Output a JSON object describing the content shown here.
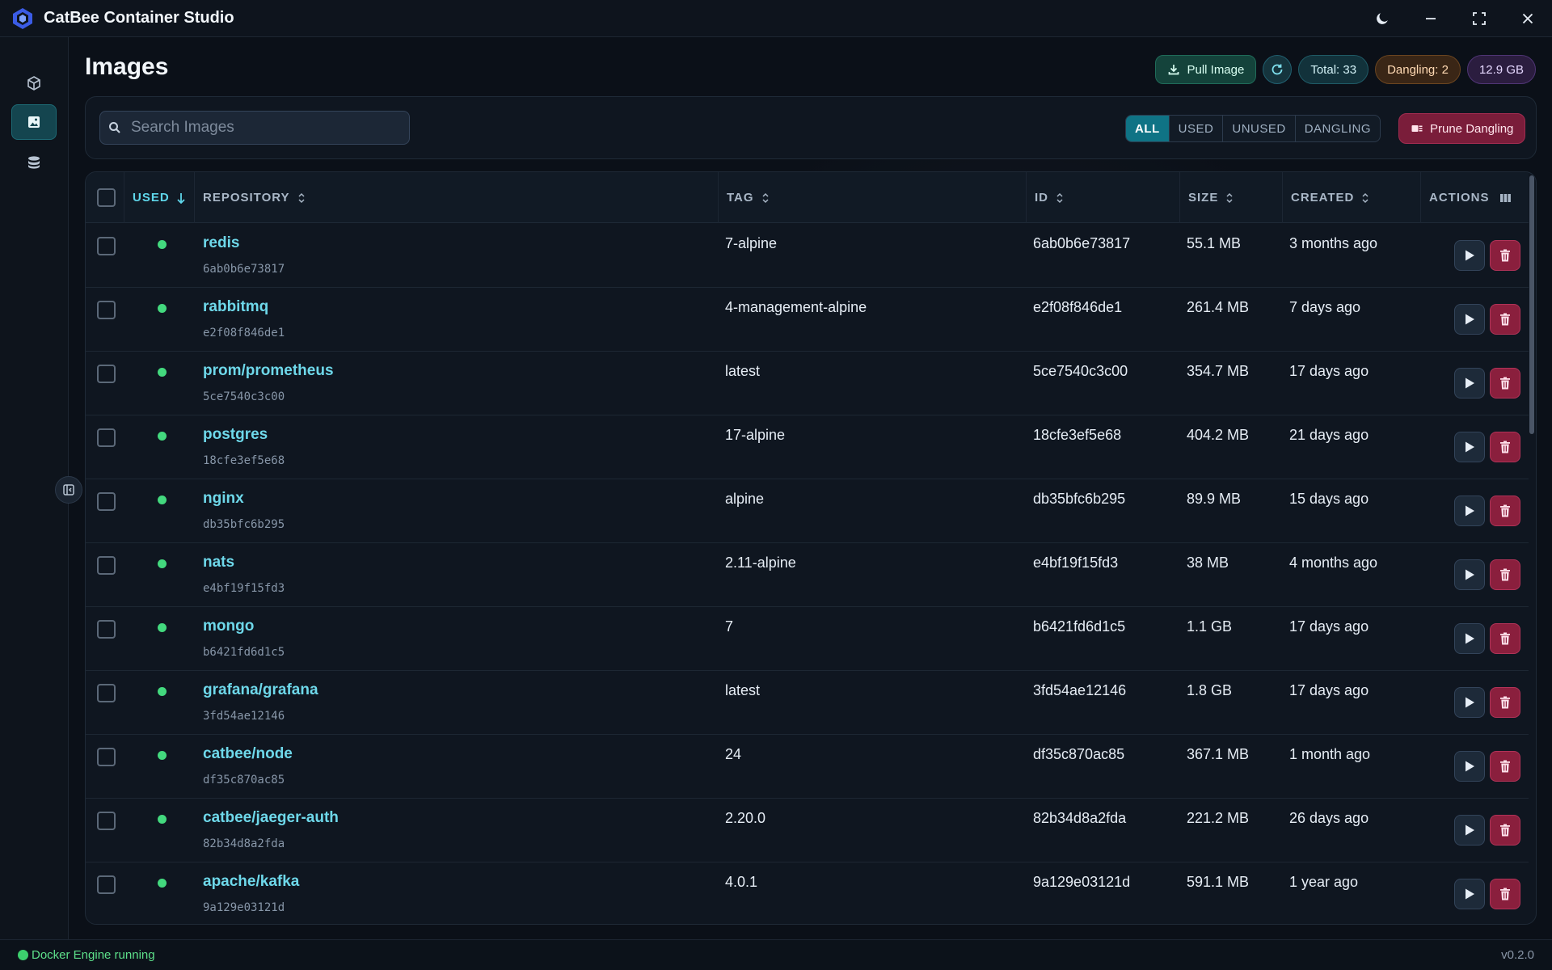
{
  "app": {
    "title": "CatBee Container Studio",
    "version": "v0.2.0"
  },
  "sidebar": {
    "items": [
      {
        "label": "Containers",
        "icon": "cube-icon",
        "active": false
      },
      {
        "label": "Images",
        "icon": "image-icon",
        "active": true
      },
      {
        "label": "Volumes",
        "icon": "database-icon",
        "active": false
      }
    ]
  },
  "header": {
    "title": "Images",
    "pull_label": "Pull Image",
    "total": "Total: 33",
    "dangling": "Dangling: 2",
    "size": "12.9 GB"
  },
  "filters": {
    "search_placeholder": "Search Images",
    "tabs": [
      "ALL",
      "USED",
      "UNUSED",
      "DANGLING"
    ],
    "active_tab": "ALL",
    "prune_label": "Prune Dangling"
  },
  "table": {
    "columns": {
      "used": "USED",
      "repository": "REPOSITORY",
      "tag": "TAG",
      "id": "ID",
      "size": "SIZE",
      "created": "CREATED",
      "actions": "ACTIONS"
    },
    "sort": {
      "column": "USED",
      "direction": "desc"
    },
    "rows": [
      {
        "repository": "redis",
        "short_id": "6ab0b6e73817",
        "tag": "7-alpine",
        "id": "6ab0b6e73817",
        "size": "55.1 MB",
        "created": "3 months ago",
        "used": true
      },
      {
        "repository": "rabbitmq",
        "short_id": "e2f08f846de1",
        "tag": "4-management-alpine",
        "id": "e2f08f846de1",
        "size": "261.4 MB",
        "created": "7 days ago",
        "used": true
      },
      {
        "repository": "prom/prometheus",
        "short_id": "5ce7540c3c00",
        "tag": "latest",
        "id": "5ce7540c3c00",
        "size": "354.7 MB",
        "created": "17 days ago",
        "used": true
      },
      {
        "repository": "postgres",
        "short_id": "18cfe3ef5e68",
        "tag": "17-alpine",
        "id": "18cfe3ef5e68",
        "size": "404.2 MB",
        "created": "21 days ago",
        "used": true
      },
      {
        "repository": "nginx",
        "short_id": "db35bfc6b295",
        "tag": "alpine",
        "id": "db35bfc6b295",
        "size": "89.9 MB",
        "created": "15 days ago",
        "used": true
      },
      {
        "repository": "nats",
        "short_id": "e4bf19f15fd3",
        "tag": "2.11-alpine",
        "id": "e4bf19f15fd3",
        "size": "38 MB",
        "created": "4 months ago",
        "used": true
      },
      {
        "repository": "mongo",
        "short_id": "b6421fd6d1c5",
        "tag": "7",
        "id": "b6421fd6d1c5",
        "size": "1.1 GB",
        "created": "17 days ago",
        "used": true
      },
      {
        "repository": "grafana/grafana",
        "short_id": "3fd54ae12146",
        "tag": "latest",
        "id": "3fd54ae12146",
        "size": "1.8 GB",
        "created": "17 days ago",
        "used": true
      },
      {
        "repository": "catbee/node",
        "short_id": "df35c870ac85",
        "tag": "24",
        "id": "df35c870ac85",
        "size": "367.1 MB",
        "created": "1 month ago",
        "used": true
      },
      {
        "repository": "catbee/jaeger-auth",
        "short_id": "82b34d8a2fda",
        "tag": "2.20.0",
        "id": "82b34d8a2fda",
        "size": "221.2 MB",
        "created": "26 days ago",
        "used": true
      },
      {
        "repository": "apache/kafka",
        "short_id": "9a129e03121d",
        "tag": "4.0.1",
        "id": "9a129e03121d",
        "size": "591.1 MB",
        "created": "1 year ago",
        "used": true
      }
    ]
  },
  "status": {
    "text": "Docker Engine running"
  },
  "colors": {
    "accent": "#0f7385",
    "used_dot": "#43d97e",
    "repo_link": "#6ed8ea",
    "danger": "#8a1f3d"
  }
}
